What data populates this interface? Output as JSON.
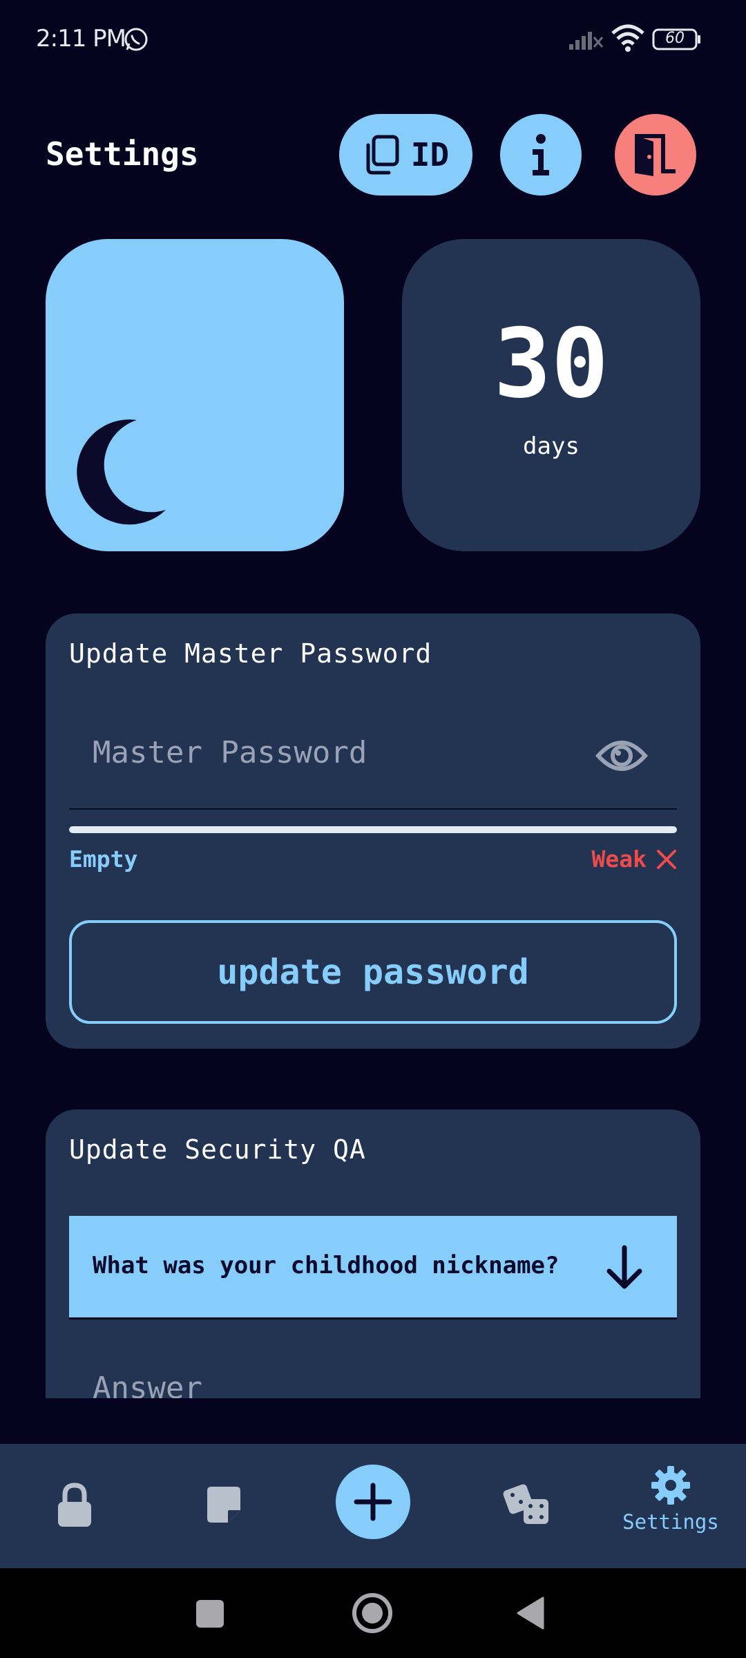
{
  "status_bar": {
    "time": "2:11 PM",
    "battery": "60",
    "icons": [
      "whatsapp-icon",
      "signal-off-icon",
      "wifi-icon",
      "battery-icon"
    ]
  },
  "header": {
    "title": "Settings",
    "id_button_label": "ID",
    "icons": [
      "copy-icon",
      "info-icon",
      "logout-door-icon"
    ]
  },
  "theme_card": {
    "icon": "moon-icon"
  },
  "days_card": {
    "number": "30",
    "label": "days"
  },
  "master_password": {
    "title": "Update Master Password",
    "placeholder": "Master Password",
    "value": "",
    "strength_left": "Empty",
    "strength_right": "Weak",
    "strength_fraction": 0,
    "button_label": "update password"
  },
  "security_qa": {
    "title": "Update Security QA",
    "selected_question": "What was your childhood nickname?",
    "answer_placeholder": "Answer"
  },
  "bottom_nav": {
    "items": [
      {
        "icon": "lock-icon",
        "label": ""
      },
      {
        "icon": "note-icon",
        "label": ""
      },
      {
        "icon": "plus-icon",
        "label": ""
      },
      {
        "icon": "dice-icon",
        "label": ""
      },
      {
        "icon": "gear-icon",
        "label": "Settings"
      }
    ],
    "active": "Settings"
  },
  "colors": {
    "background": "#06031f",
    "card": "#233352",
    "accent": "#87cdfb",
    "danger": "#f04b4b",
    "logout": "#f77f7c"
  }
}
